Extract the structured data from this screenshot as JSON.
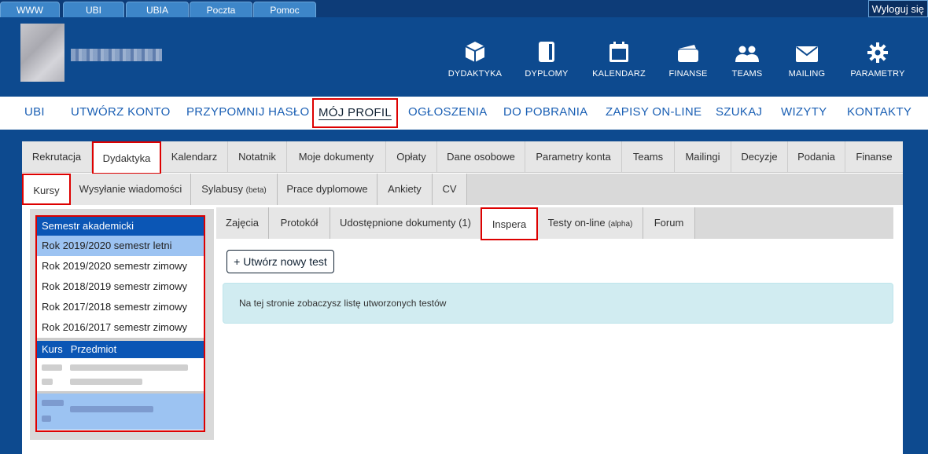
{
  "top_tabs": [
    "WWW",
    "UBI",
    "UBIA",
    "Poczta",
    "Pomoc"
  ],
  "logout": "Wyloguj się",
  "header_icons": [
    {
      "label": "DYDAKTYKA",
      "icon": "cube-icon"
    },
    {
      "label": "DYPLOMY",
      "icon": "book-icon"
    },
    {
      "label": "KALENDARZ",
      "icon": "calendar-icon"
    },
    {
      "label": "FINANSE",
      "icon": "wallet-icon"
    },
    {
      "label": "TEAMS",
      "icon": "users-icon"
    },
    {
      "label": "MAILING",
      "icon": "envelope-icon"
    },
    {
      "label": "PARAMETRY",
      "icon": "gear-icon"
    }
  ],
  "main_nav": [
    "UBI",
    "UTWÓRZ KONTO",
    "PRZYPOMNIJ HASŁO",
    "MÓJ PROFIL",
    "OGŁOSZENIA",
    "DO POBRANIA",
    "ZAPISY ON-LINE",
    "SZUKAJ",
    "WIZYTY",
    "KONTAKTY"
  ],
  "tabs_level1": [
    "Rekrutacja",
    "Dydaktyka",
    "Kalendarz",
    "Notatnik",
    "Moje dokumenty",
    "Opłaty",
    "Dane osobowe",
    "Parametry konta",
    "Teams",
    "Mailingi",
    "Decyzje",
    "Podania",
    "Finanse"
  ],
  "tabs_level2": [
    {
      "label": "Kursy",
      "suffix": ""
    },
    {
      "label": "Wysyłanie wiadomości",
      "suffix": ""
    },
    {
      "label": "Sylabusy",
      "suffix": "(beta)"
    },
    {
      "label": "Prace dyplomowe",
      "suffix": ""
    },
    {
      "label": "Ankiety",
      "suffix": ""
    },
    {
      "label": "CV",
      "suffix": ""
    }
  ],
  "sidebar": {
    "semester_header": "Semestr akademicki",
    "semesters": [
      "Rok 2019/2020 semestr letni",
      "Rok 2019/2020 semestr zimowy",
      "Rok 2018/2019 semestr zimowy",
      "Rok 2017/2018 semestr zimowy",
      "Rok 2016/2017 semestr zimowy"
    ],
    "course_header_kurs": "Kurs",
    "course_header_przedmiot": "Przedmiot"
  },
  "tabs_level3": [
    {
      "label": "Zajęcia",
      "suffix": ""
    },
    {
      "label": "Protokół",
      "suffix": ""
    },
    {
      "label": "Udostępnione dokumenty (1)",
      "suffix": ""
    },
    {
      "label": "Inspera",
      "suffix": ""
    },
    {
      "label": "Testy on-line",
      "suffix": "(alpha)"
    },
    {
      "label": "Forum",
      "suffix": ""
    }
  ],
  "new_test_button": "+ Utwórz nowy test",
  "info_message": "Na tej stronie zobaczysz listę utworzonych testów",
  "colors": {
    "header_bg": "#0d4a8f",
    "active_outline": "#dd0000",
    "selected_row": "#9cc3f2",
    "info_bg": "#d1ecf1"
  }
}
